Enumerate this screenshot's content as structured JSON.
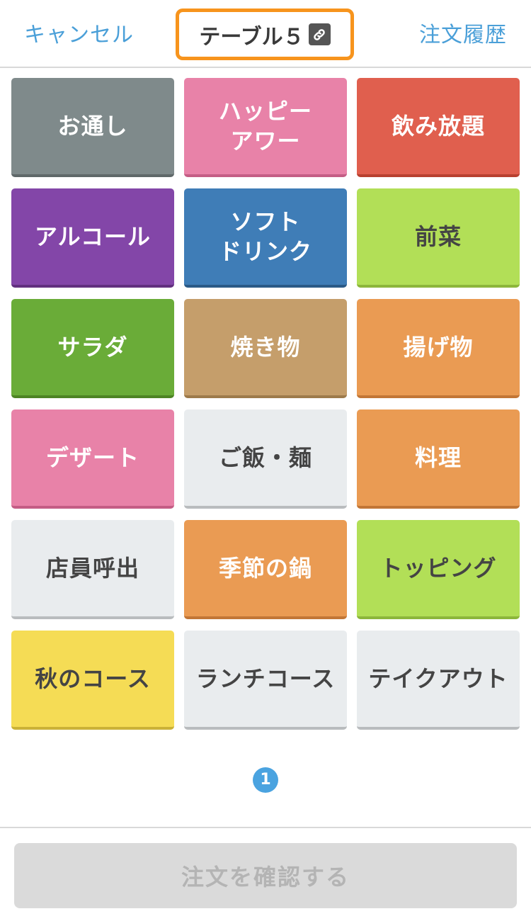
{
  "header": {
    "cancel_label": "キャンセル",
    "title": "テーブル５",
    "title_icon": "link-icon",
    "history_label": "注文履歴",
    "accent_color": "#f7941d"
  },
  "categories": [
    {
      "label": "お通し",
      "bg": "#7f8a8b",
      "fg": "#ffffff",
      "border": "#5f6869"
    },
    {
      "label": "ハッピー\nアワー",
      "bg": "#e882a8",
      "fg": "#ffffff",
      "border": "#c45d85"
    },
    {
      "label": "飲み放題",
      "bg": "#e05f4e",
      "fg": "#ffffff",
      "border": "#b8402f"
    },
    {
      "label": "アルコール",
      "bg": "#8346a8",
      "fg": "#ffffff",
      "border": "#62307f"
    },
    {
      "label": "ソフト\nドリンク",
      "bg": "#3f7db7",
      "fg": "#ffffff",
      "border": "#2b5a87"
    },
    {
      "label": "前菜",
      "bg": "#b2df57",
      "fg": "#444444",
      "border": "#8cb63b"
    },
    {
      "label": "サラダ",
      "bg": "#6aac38",
      "fg": "#ffffff",
      "border": "#4d8424"
    },
    {
      "label": "焼き物",
      "bg": "#c59e6b",
      "fg": "#ffffff",
      "border": "#9d7a4b"
    },
    {
      "label": "揚げ物",
      "bg": "#ea9b53",
      "fg": "#ffffff",
      "border": "#c27636"
    },
    {
      "label": "デザート",
      "bg": "#e882a8",
      "fg": "#ffffff",
      "border": "#c45d85"
    },
    {
      "label": "ご飯・麺",
      "bg": "#e9ecee",
      "fg": "#444444",
      "border": "#b9bcbe"
    },
    {
      "label": "料理",
      "bg": "#ea9b53",
      "fg": "#ffffff",
      "border": "#c27636"
    },
    {
      "label": "店員呼出",
      "bg": "#e9ecee",
      "fg": "#444444",
      "border": "#b9bcbe"
    },
    {
      "label": "季節の鍋",
      "bg": "#ea9b53",
      "fg": "#ffffff",
      "border": "#c27636"
    },
    {
      "label": "トッピング",
      "bg": "#b2df57",
      "fg": "#444444",
      "border": "#8cb63b"
    },
    {
      "label": "秋のコース",
      "bg": "#f5dc55",
      "fg": "#444444",
      "border": "#cbb237"
    },
    {
      "label": "ランチコース",
      "bg": "#e9ecee",
      "fg": "#444444",
      "border": "#b9bcbe"
    },
    {
      "label": "テイクアウト",
      "bg": "#e9ecee",
      "fg": "#444444",
      "border": "#b9bcbe"
    }
  ],
  "pagination": {
    "current": "1"
  },
  "footer": {
    "confirm_label": "注文を確認する"
  }
}
